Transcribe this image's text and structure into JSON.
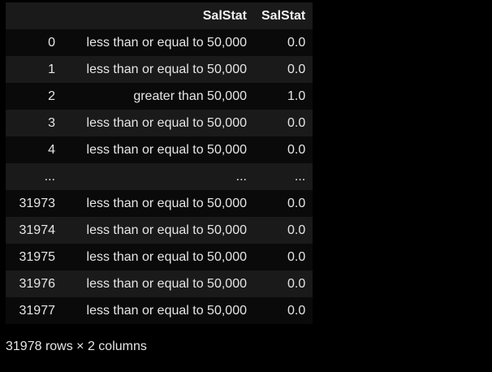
{
  "table": {
    "columns": [
      "",
      "SalStat",
      "SalStat"
    ],
    "rows": [
      [
        "0",
        "less than or equal to 50,000",
        "0.0"
      ],
      [
        "1",
        "less than or equal to 50,000",
        "0.0"
      ],
      [
        "2",
        "greater than 50,000",
        "1.0"
      ],
      [
        "3",
        "less than or equal to 50,000",
        "0.0"
      ],
      [
        "4",
        "less than or equal to 50,000",
        "0.0"
      ],
      [
        "...",
        "...",
        "..."
      ],
      [
        "31973",
        "less than or equal to 50,000",
        "0.0"
      ],
      [
        "31974",
        "less than or equal to 50,000",
        "0.0"
      ],
      [
        "31975",
        "less than or equal to 50,000",
        "0.0"
      ],
      [
        "31976",
        "less than or equal to 50,000",
        "0.0"
      ],
      [
        "31977",
        "less than or equal to 50,000",
        "0.0"
      ]
    ]
  },
  "footer": {
    "shape_text": "31978 rows × 2 columns"
  },
  "colors": {
    "background": "#000000",
    "row_stripe": "#1a1a1a",
    "text": "#e6e6e6"
  }
}
